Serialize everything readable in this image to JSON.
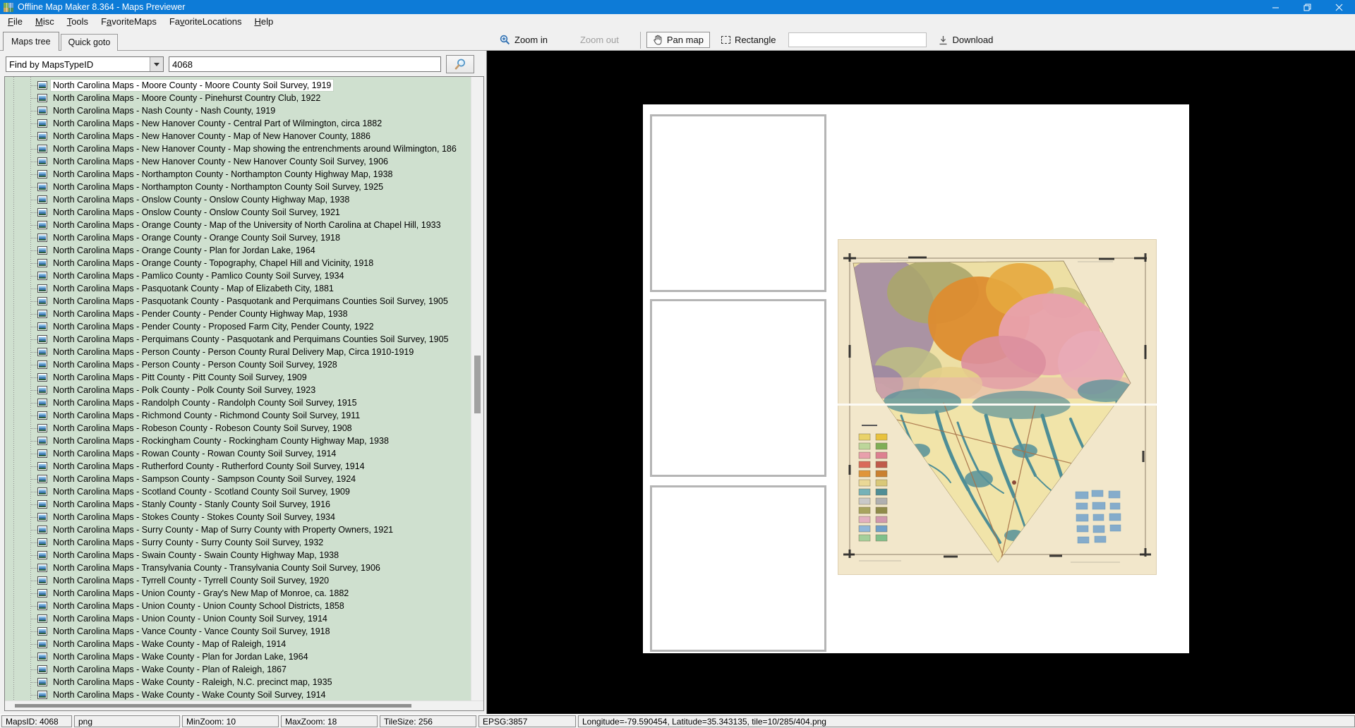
{
  "window": {
    "title": "Offline Map Maker 8.364 - Maps Previewer"
  },
  "menu": {
    "items": [
      {
        "pre": "",
        "key": "F",
        "post": "ile"
      },
      {
        "pre": "",
        "key": "M",
        "post": "isc"
      },
      {
        "pre": "",
        "key": "T",
        "post": "ools"
      },
      {
        "pre": "F",
        "key": "a",
        "post": "voriteMaps"
      },
      {
        "pre": "Fa",
        "key": "v",
        "post": "oriteLocations"
      },
      {
        "pre": "",
        "key": "H",
        "post": "elp"
      }
    ]
  },
  "tabs": {
    "items": [
      "Maps tree",
      "Quick goto"
    ],
    "active_index": 0
  },
  "search": {
    "filter_value": "Find by MapsTypeID",
    "query_value": "4068"
  },
  "toolbar": {
    "zoom_in": "Zoom in",
    "zoom_out": "Zoom out",
    "pan_map": "Pan map",
    "rectangle": "Rectangle",
    "download": "Download",
    "text_field_value": ""
  },
  "tree": {
    "selected_index": 0,
    "items": [
      "North Carolina Maps - Moore County - Moore County Soil Survey, 1919",
      "North Carolina Maps - Moore County - Pinehurst Country Club, 1922",
      "North Carolina Maps - Nash County - Nash County, 1919",
      "North Carolina Maps - New Hanover County - Central Part of Wilmington, circa 1882",
      "North Carolina Maps - New Hanover County - Map of New Hanover County, 1886",
      "North Carolina Maps - New Hanover County - Map showing the entrenchments around Wilmington, 186",
      "North Carolina Maps - New Hanover County - New Hanover County Soil Survey, 1906",
      "North Carolina Maps - Northampton County - Northampton County Highway Map, 1938",
      "North Carolina Maps - Northampton County - Northampton County Soil Survey, 1925",
      "North Carolina Maps - Onslow County - Onslow County Highway Map, 1938",
      "North Carolina Maps - Onslow County - Onslow County Soil Survey, 1921",
      "North Carolina Maps - Orange County - Map of the University of North Carolina at Chapel Hill, 1933",
      "North Carolina Maps - Orange County - Orange County Soil Survey, 1918",
      "North Carolina Maps - Orange County - Plan for Jordan Lake, 1964",
      "North Carolina Maps - Orange County - Topography, Chapel Hill and Vicinity, 1918",
      "North Carolina Maps - Pamlico County - Pamlico County Soil Survey, 1934",
      "North Carolina Maps - Pasquotank County - Map of Elizabeth City, 1881",
      "North Carolina Maps - Pasquotank County - Pasquotank and Perquimans Counties Soil Survey, 1905",
      "North Carolina Maps - Pender County - Pender County Highway Map, 1938",
      "North Carolina Maps - Pender County - Proposed Farm City, Pender County, 1922",
      "North Carolina Maps - Perquimans County - Pasquotank and Perquimans Counties Soil Survey, 1905",
      "North Carolina Maps - Person County - Person County Rural Delivery Map, Circa 1910-1919",
      "North Carolina Maps - Person County - Person County Soil Survey, 1928",
      "North Carolina Maps - Pitt County - Pitt County Soil Survey, 1909",
      "North Carolina Maps - Polk County - Polk County Soil Survey, 1923",
      "North Carolina Maps - Randolph County - Randolph County Soil Survey, 1915",
      "North Carolina Maps - Richmond County - Richmond County Soil Survey, 1911",
      "North Carolina Maps - Robeson County - Robeson County Soil Survey, 1908",
      "North Carolina Maps - Rockingham County - Rockingham County Highway Map, 1938",
      "North Carolina Maps - Rowan County - Rowan County Soil Survey, 1914",
      "North Carolina Maps - Rutherford County - Rutherford County Soil Survey, 1914",
      "North Carolina Maps - Sampson County - Sampson County Soil Survey, 1924",
      "North Carolina Maps - Scotland County - Scotland County Soil Survey, 1909",
      "North Carolina Maps - Stanly County - Stanly County Soil Survey, 1916",
      "North Carolina Maps - Stokes County - Stokes County Soil Survey, 1934",
      "North Carolina Maps - Surry County - Map of Surry County with Property Owners, 1921",
      "North Carolina Maps - Surry County - Surry County Soil Survey, 1932",
      "North Carolina Maps - Swain County - Swain County Highway Map, 1938",
      "North Carolina Maps - Transylvania County - Transylvania County Soil Survey, 1906",
      "North Carolina Maps - Tyrrell County - Tyrrell County Soil Survey, 1920",
      "North Carolina Maps - Union County - Gray's New Map of Monroe, ca. 1882",
      "North Carolina Maps - Union County - Union County School Districts, 1858",
      "North Carolina Maps - Union County - Union County Soil Survey, 1914",
      "North Carolina Maps - Vance County - Vance County Soil Survey, 1918",
      "North Carolina Maps - Wake County - Map of Raleigh, 1914",
      "North Carolina Maps - Wake County - Plan for Jordan Lake, 1964",
      "North Carolina Maps - Wake County - Plan of Raleigh, 1867",
      "North Carolina Maps - Wake County - Raleigh, N.C. precinct map, 1935",
      "North Carolina Maps - Wake County - Wake County Soil Survey, 1914"
    ]
  },
  "status": {
    "segments": [
      "MapsID: 4068",
      "png",
      "MinZoom: 10",
      "MaxZoom: 18",
      "TileSize: 256",
      "EPSG:3857",
      "Longitude=-79.590454, Latitude=35.343135, tile=10/285/404.png"
    ]
  },
  "colors": {
    "titlebar": "#0d7bd7",
    "tree_background": "#cfe0cf",
    "selection_background": "#ffffff",
    "map_canvas_background": "#000000"
  }
}
